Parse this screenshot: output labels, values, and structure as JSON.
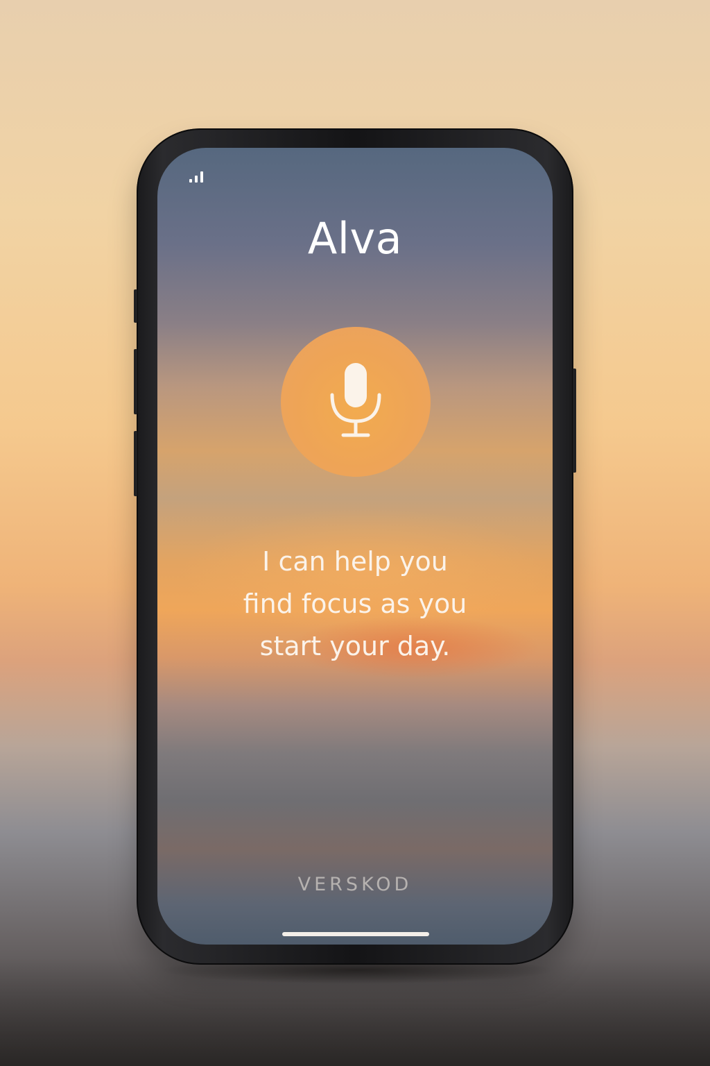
{
  "status_bar": {
    "signal_icon": "cellular-signal-icon"
  },
  "app": {
    "title": "Alva"
  },
  "mic": {
    "icon": "microphone-icon",
    "button_color": "#eea457"
  },
  "message": {
    "lines": [
      "I can help you",
      "find focus as you",
      "start your day."
    ]
  },
  "footer": {
    "brand": "VERSKOD"
  }
}
